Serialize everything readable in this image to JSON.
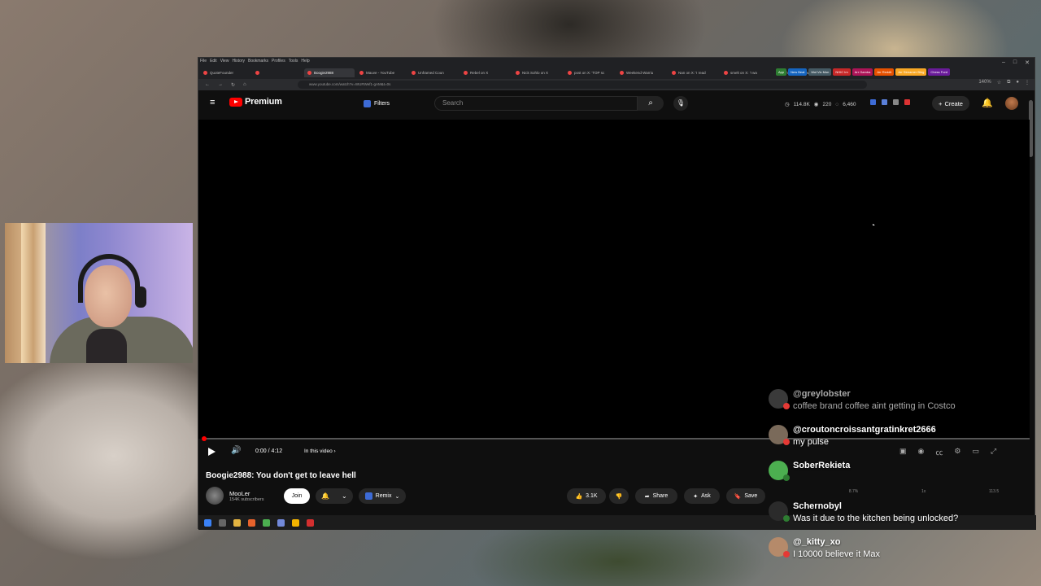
{
  "browser": {
    "menu": [
      "File",
      "Edit",
      "View",
      "History",
      "Bookmarks",
      "Profiles",
      "Tools",
      "Help"
    ],
    "tabs": [
      "QuoteFounder",
      "",
      "Boogie2988",
      "Mauve - YouTube",
      "Unframed Coun",
      "Rebel on X",
      "Nick Sohlo on X",
      "post on X: 'TOP sc",
      "Weekend Warriu",
      "Nan on X: 'I read",
      "smelt on X: 'I wa",
      "GTA 6 Countdown"
    ],
    "tab_groups": [
      {
        "label": "App",
        "color": "#2e7d32"
      },
      {
        "label": "New Beat",
        "color": "#1565c0"
      },
      {
        "label": "Mol Vic Mon",
        "color": "#455a64"
      },
      {
        "label": "NHIC Im",
        "color": "#c62828"
      },
      {
        "label": "Arr Gamba",
        "color": "#ad1457"
      },
      {
        "label": "Arr Reddit",
        "color": "#e65100"
      },
      {
        "label": "Arr Streamer Bing",
        "color": "#f9a825"
      },
      {
        "label": "Chess Ford",
        "color": "#6a1b9a"
      }
    ],
    "url": "www.youtube.com/watch?v=WURWef1-gAM&t=0s",
    "zoom": "140%"
  },
  "youtube": {
    "logo_text": "Premium",
    "filters_label": "Filters",
    "search_placeholder": "Search",
    "stats": {
      "views": "114.8K",
      "eyes": "220",
      "likes": "6,460"
    },
    "create_label": "Create",
    "player": {
      "time": "0:00 / 4:12",
      "in_this_video": "In this video",
      "progress": 0.0
    },
    "video_title": "Boogie2988: You don't get to leave hell",
    "channel": {
      "name": "MooLer",
      "subscribers": "154K subscribers"
    },
    "join_label": "Join",
    "remix_label": "Remix",
    "like_count": "3.1K",
    "share_label": "Share",
    "ask_label": "Ask",
    "save_label": "Save",
    "playback_stats": {
      "a": "8.7%",
      "b": "1x",
      "c": "113.5"
    }
  },
  "chat": [
    {
      "user": "@greylobster",
      "text": "coffee brand coffee aint getting in Costco",
      "avatar_color": "#3a3a3a",
      "badge_color": "#e53935",
      "dim": true
    },
    {
      "user": "@croutoncroissantgratinkret2666",
      "text": "my pulse",
      "avatar_color": "#7a6a5a",
      "badge_color": "#e53935",
      "dim": false
    },
    {
      "user": "SoberRekieta",
      "text": "",
      "avatar_color": "#4caf50",
      "badge_color": "#2e7d32",
      "dim": false
    },
    {
      "user": "Schernobyl",
      "text": "Was it due to the kitchen being unlocked?",
      "avatar_color": "#2b2b2b",
      "badge_color": "#2e7d32",
      "dim": false
    },
    {
      "user": "@_kitty_xo",
      "text": "I 10000 believe it Max",
      "avatar_color": "#b58a6a",
      "badge_color": "#e53935",
      "dim": false
    }
  ],
  "colors": {
    "accent_red": "#ff0000",
    "youtube_bg": "#0f0f0f"
  }
}
